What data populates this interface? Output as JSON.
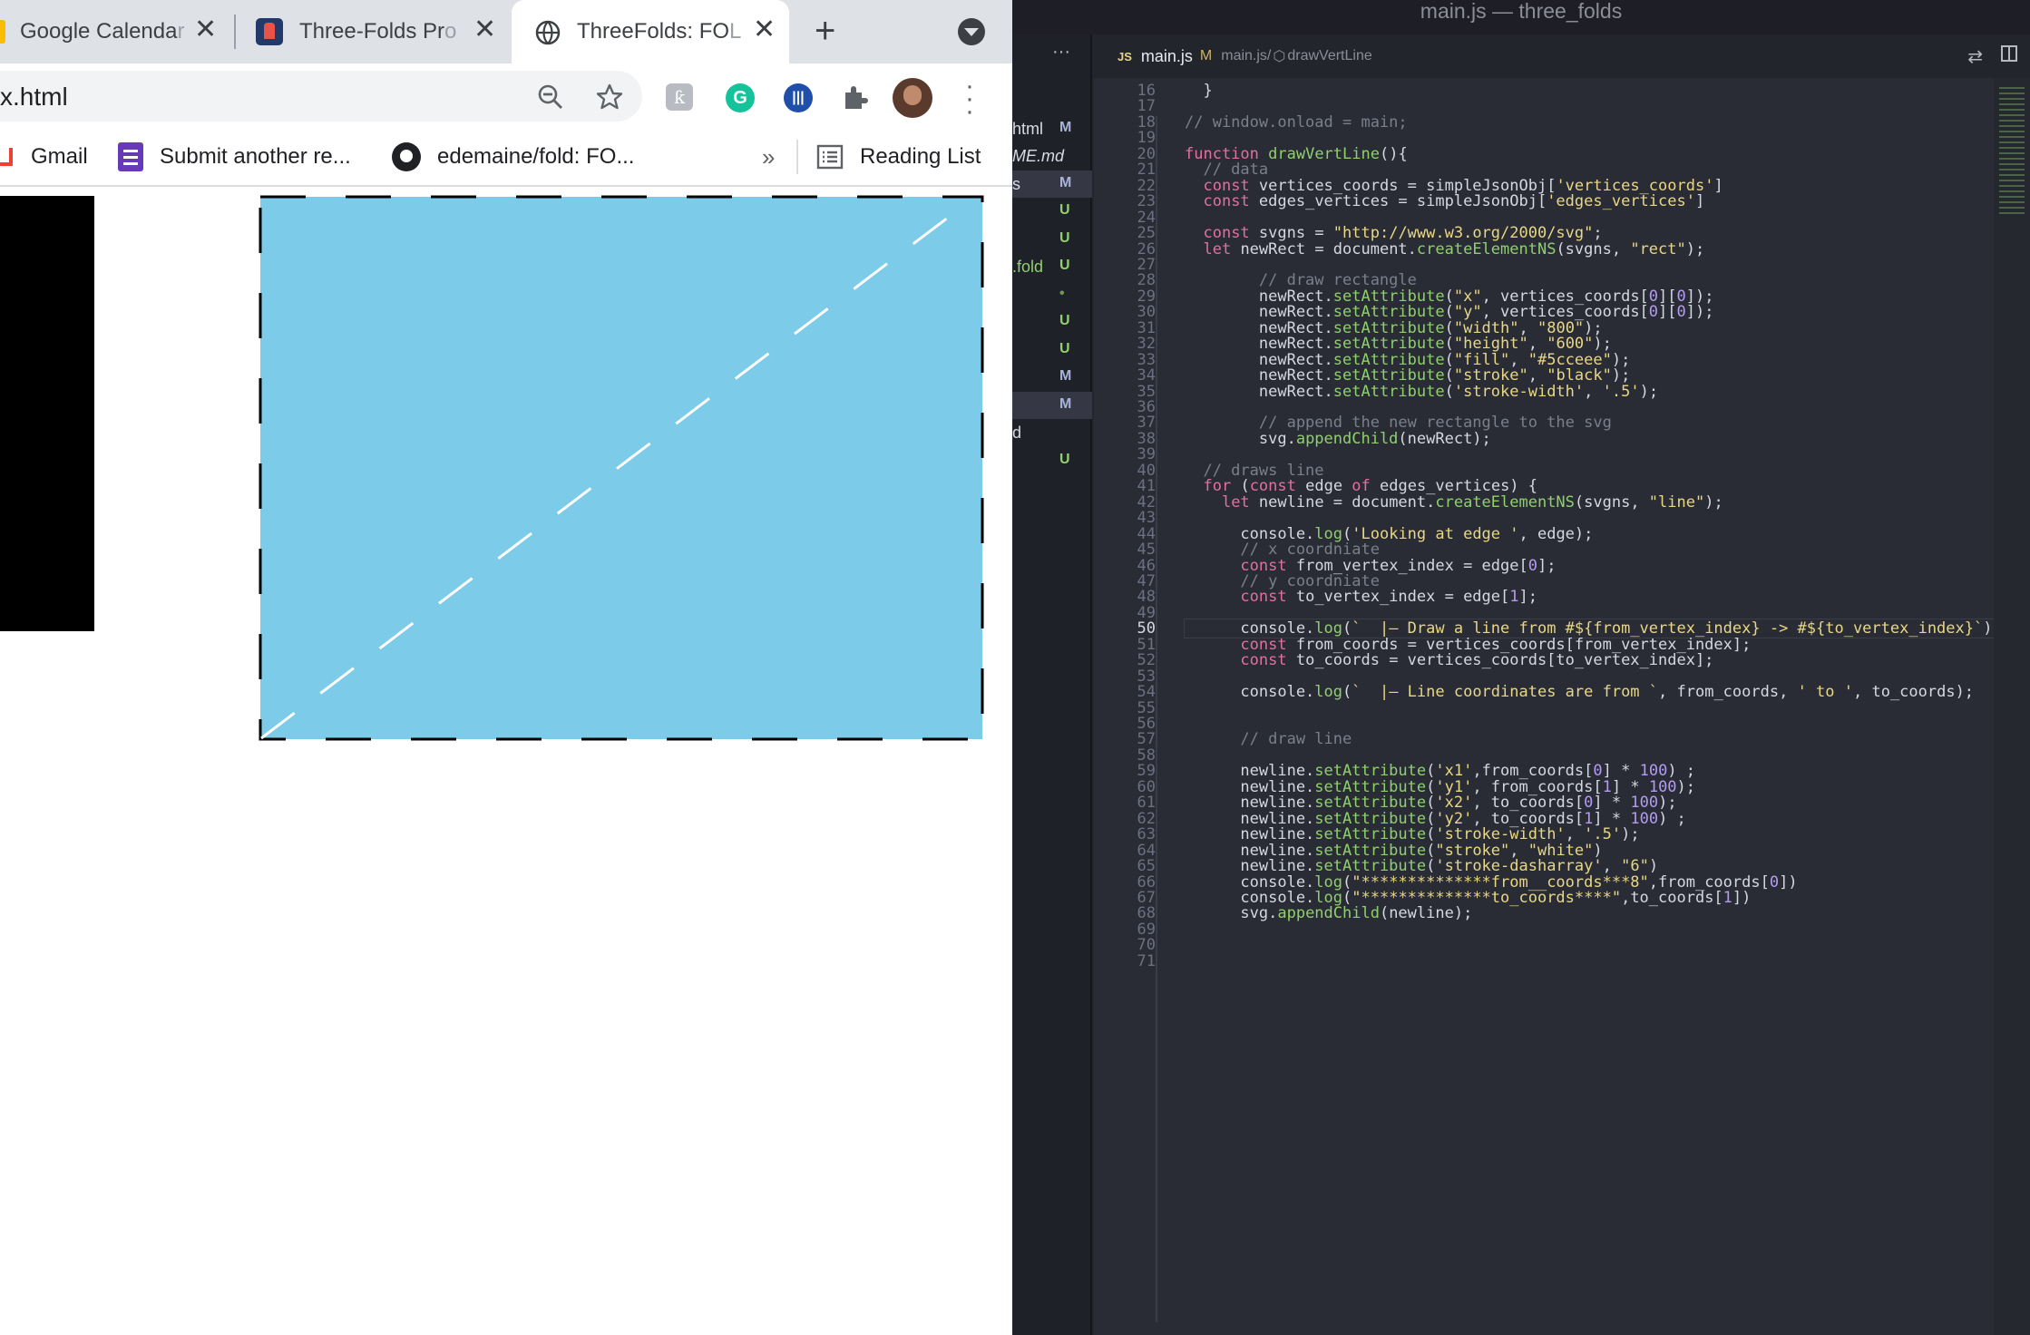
{
  "browser": {
    "tabs": [
      {
        "title": "Google Calenda",
        "fade": "r"
      },
      {
        "title": "Three-Folds Pr",
        "fade": "o"
      },
      {
        "title": "ThreeFolds: FO",
        "fade": "L"
      }
    ],
    "new_tab": "+",
    "url": "x.html",
    "bookmarks": [
      "Gmail",
      "Submit another re...",
      "edemaine/fold: FO..."
    ],
    "more": "»",
    "reading_list": "Reading List",
    "colors": {
      "rect_fill": "#7bcbe9",
      "tabstrip": "#dee1e6"
    }
  },
  "vscode": {
    "title": "main.js — three_folds",
    "tab": {
      "icon": "JS",
      "name": "main.js",
      "badge": "M",
      "breadcrumb_file": "main.js/",
      "breadcrumb_fn": "drawVertLine"
    },
    "more_icon": "···",
    "explorer": [
      {
        "name": "",
        "badge": ""
      },
      {
        "name": "html",
        "badge": "M"
      },
      {
        "name": "ME.md",
        "badge": ""
      },
      {
        "name": "s",
        "badge": "M"
      },
      {
        "name": "",
        "badge": "U"
      },
      {
        "name": "",
        "badge": "U"
      },
      {
        "name": ".fold",
        "badge": "U"
      },
      {
        "name": "",
        "badge": "•"
      },
      {
        "name": "",
        "badge": "U"
      },
      {
        "name": "",
        "badge": "U"
      },
      {
        "name": "",
        "badge": "M"
      },
      {
        "name": "",
        "badge": "M"
      },
      {
        "name": "d",
        "badge": ""
      },
      {
        "name": "",
        "badge": "U"
      }
    ],
    "code": [
      {
        "n": "16",
        "t": "  }"
      },
      {
        "n": "17",
        "t": ""
      },
      {
        "n": "18",
        "t": "// window.onload = main;"
      },
      {
        "n": "19",
        "t": ""
      },
      {
        "n": "20",
        "t": "function drawVertLine(){"
      },
      {
        "n": "21",
        "t": "  // data"
      },
      {
        "n": "22",
        "t": "  const vertices_coords = simpleJsonObj['vertices_coords']"
      },
      {
        "n": "23",
        "t": "  const edges_vertices = simpleJsonObj['edges_vertices']"
      },
      {
        "n": "24",
        "t": ""
      },
      {
        "n": "25",
        "t": "  const svgns = \"http://www.w3.org/2000/svg\";"
      },
      {
        "n": "26",
        "t": "  let newRect = document.createElementNS(svgns, \"rect\");"
      },
      {
        "n": "27",
        "t": ""
      },
      {
        "n": "28",
        "t": "        // draw rectangle"
      },
      {
        "n": "29",
        "t": "        newRect.setAttribute(\"x\", vertices_coords[0][0]);"
      },
      {
        "n": "30",
        "t": "        newRect.setAttribute(\"y\", vertices_coords[0][0]);"
      },
      {
        "n": "31",
        "t": "        newRect.setAttribute(\"width\", \"800\");"
      },
      {
        "n": "32",
        "t": "        newRect.setAttribute(\"height\", \"600\");"
      },
      {
        "n": "33",
        "t": "        newRect.setAttribute(\"fill\", \"#5cceee\");"
      },
      {
        "n": "34",
        "t": "        newRect.setAttribute(\"stroke\", \"black\");"
      },
      {
        "n": "35",
        "t": "        newRect.setAttribute('stroke-width', '.5');"
      },
      {
        "n": "36",
        "t": ""
      },
      {
        "n": "37",
        "t": "        // append the new rectangle to the svg"
      },
      {
        "n": "38",
        "t": "        svg.appendChild(newRect);"
      },
      {
        "n": "39",
        "t": ""
      },
      {
        "n": "40",
        "t": "  // draws line"
      },
      {
        "n": "41",
        "t": "  for (const edge of edges_vertices) {"
      },
      {
        "n": "42",
        "t": "    let newline = document.createElementNS(svgns, \"line\");"
      },
      {
        "n": "43",
        "t": ""
      },
      {
        "n": "44",
        "t": "      console.log('Looking at edge ', edge);"
      },
      {
        "n": "45",
        "t": "      // x coordniate"
      },
      {
        "n": "46",
        "t": "      const from_vertex_index = edge[0];"
      },
      {
        "n": "47",
        "t": "      // y coordniate"
      },
      {
        "n": "48",
        "t": "      const to_vertex_index = edge[1];"
      },
      {
        "n": "49",
        "t": ""
      },
      {
        "n": "50",
        "t": "      console.log(`  |— Draw a line from #${from_vertex_index} -> #${to_vertex_index}`);"
      },
      {
        "n": "51",
        "t": "      const from_coords = vertices_coords[from_vertex_index];"
      },
      {
        "n": "52",
        "t": "      const to_coords = vertices_coords[to_vertex_index];"
      },
      {
        "n": "53",
        "t": ""
      },
      {
        "n": "54",
        "t": "      console.log(`  |— Line coordinates are from `, from_coords, ' to ', to_coords);"
      },
      {
        "n": "55",
        "t": ""
      },
      {
        "n": "56",
        "t": ""
      },
      {
        "n": "57",
        "t": "      // draw line"
      },
      {
        "n": "58",
        "t": ""
      },
      {
        "n": "59",
        "t": "      newline.setAttribute('x1',from_coords[0] * 100) ;"
      },
      {
        "n": "60",
        "t": "      newline.setAttribute('y1', from_coords[1] * 100);"
      },
      {
        "n": "61",
        "t": "      newline.setAttribute('x2', to_coords[0] * 100);"
      },
      {
        "n": "62",
        "t": "      newline.setAttribute('y2', to_coords[1] * 100) ;"
      },
      {
        "n": "63",
        "t": "      newline.setAttribute('stroke-width', '.5');"
      },
      {
        "n": "64",
        "t": "      newline.setAttribute(\"stroke\", \"white\")"
      },
      {
        "n": "65",
        "t": "      newline.setAttribute('stroke-dasharray', \"6\")"
      },
      {
        "n": "66",
        "t": "      console.log(\"**************from__coords***8\",from_coords[0])"
      },
      {
        "n": "67",
        "t": "      console.log(\"**************to_coords****\",to_coords[1])"
      },
      {
        "n": "68",
        "t": "      svg.appendChild(newline);"
      },
      {
        "n": "69",
        "t": ""
      },
      {
        "n": "70",
        "t": ""
      },
      {
        "n": "71",
        "t": ""
      }
    ],
    "active_line": "50"
  }
}
